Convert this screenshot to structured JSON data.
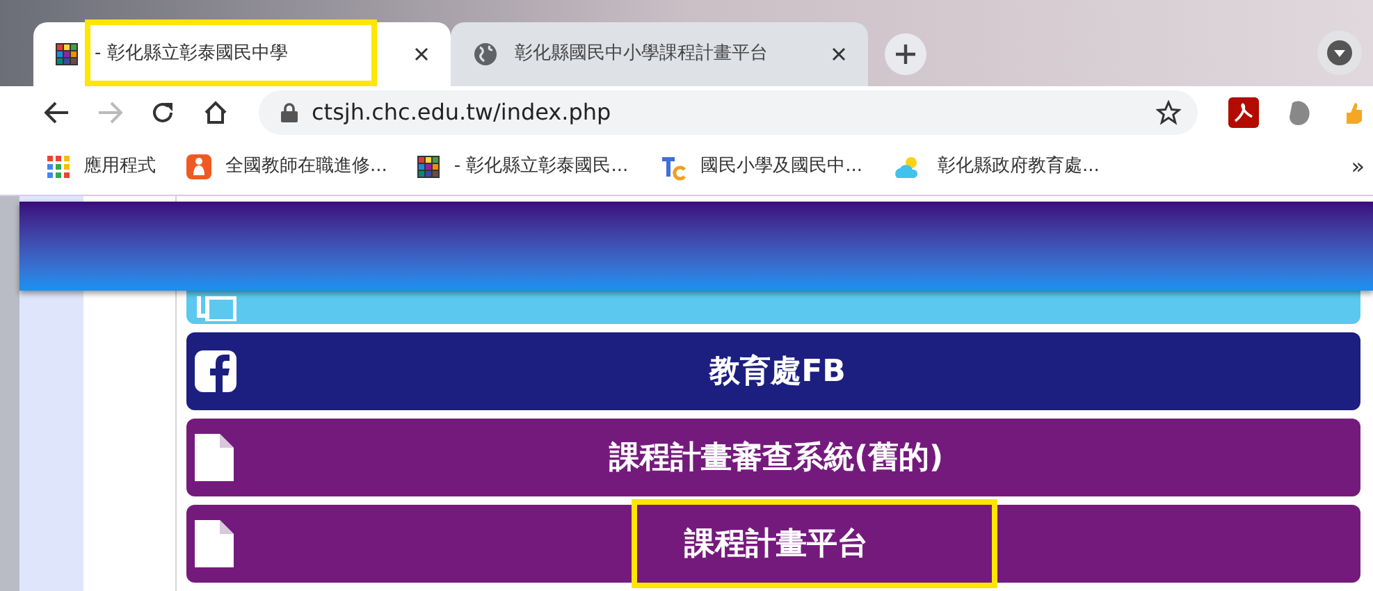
{
  "tabs": [
    {
      "title": "- 彰化縣立彰泰國民中學",
      "selected": true,
      "highlighted": true,
      "kind": "grid"
    },
    {
      "title": "彰化縣國民中小學課程計畫平台",
      "selected": false,
      "highlighted": false,
      "kind": "globe"
    }
  ],
  "address_bar": {
    "url": "ctsjh.chc.edu.tw/index.php"
  },
  "bookmarks": [
    {
      "label": "應用程式",
      "kind": "apps"
    },
    {
      "label": "全國教師在職進修...",
      "kind": "orange"
    },
    {
      "label": "- 彰化縣立彰泰國民...",
      "kind": "grid"
    },
    {
      "label": "國民小學及國民中...",
      "kind": "tc"
    },
    {
      "label": "彰化縣政府教育處...",
      "kind": "weather"
    }
  ],
  "bookmarks_overflow": "»",
  "menu_links": [
    {
      "kind": "announcement",
      "color": "#5bc8ef",
      "highlighted": false
    },
    {
      "kind": "facebook",
      "label": "教育處FB",
      "color": "#1c1f80",
      "highlighted": false
    },
    {
      "kind": "document",
      "label": "課程計畫審查系統(舊的)",
      "color": "#751a7d",
      "highlighted": false
    },
    {
      "kind": "document",
      "label": "課程計畫平台",
      "color": "#751a7d",
      "highlighted": true
    }
  ]
}
